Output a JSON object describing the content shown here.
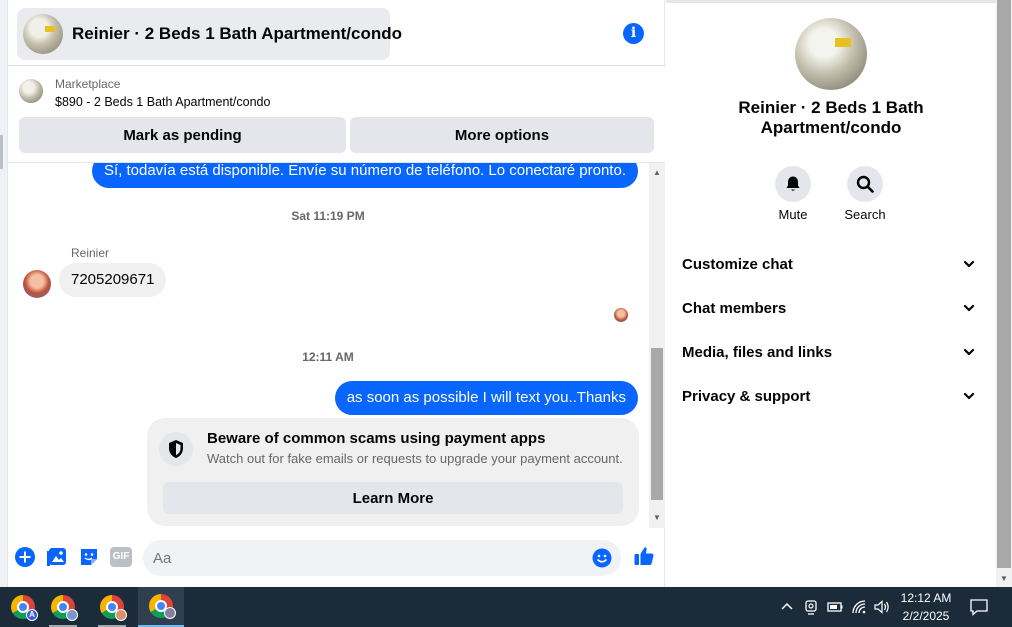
{
  "chat": {
    "title": "Reinier · 2 Beds 1 Bath Apartment/condo",
    "marketplace_label": "Marketplace",
    "listing": "$890 - 2 Beds 1 Bath Apartment/condo",
    "mark_pending": "Mark as pending",
    "more_options": "More options"
  },
  "messages": {
    "outgoing_1": "Sí, todavía está disponible. Envíe su número de teléfono. Lo conectaré pronto.",
    "timestamp_1": "Sat 11:19 PM",
    "sender_name": "Reinier",
    "incoming_1": "7205209671",
    "timestamp_2": "12:11 AM",
    "outgoing_2": "as soon as possible I will text you..Thanks"
  },
  "scam_notice": {
    "title": "Beware of common scams using payment apps",
    "subtitle": "Watch out for fake emails or requests to upgrade your payment account.",
    "button": "Learn More"
  },
  "composer": {
    "placeholder": "Aa",
    "gif_label": "GIF"
  },
  "details": {
    "title": "Reinier · 2 Beds 1 Bath Apartment/condo",
    "mute_label": "Mute",
    "search_label": "Search",
    "sections": [
      "Customize chat",
      "Chat members",
      "Media, files and links",
      "Privacy & support"
    ]
  },
  "taskbar": {
    "time": "12:12 AM",
    "date": "2/2/2025",
    "badge_letter": "A"
  },
  "colors": {
    "accent": "#0866ff",
    "taskbar": "#1c2b3a"
  }
}
